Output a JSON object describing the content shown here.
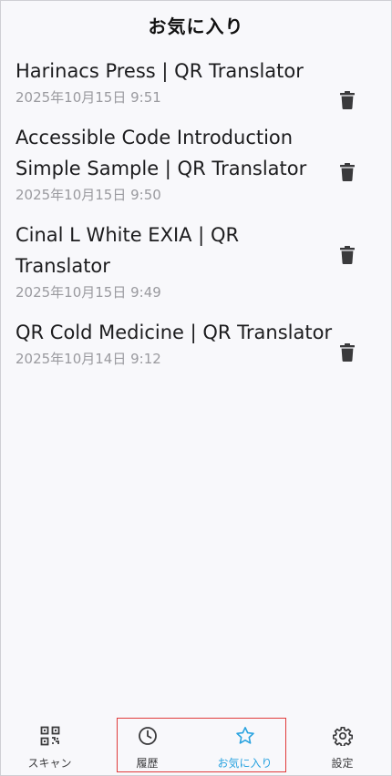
{
  "header": {
    "title": "お気に入り"
  },
  "favorites": [
    {
      "title": "Harinacs Press | QR Translator",
      "date": "2025年10月15日 9:51"
    },
    {
      "title": "Accessible Code Introduction Simple Sample | QR Translator",
      "date": "2025年10月15日 9:50"
    },
    {
      "title": "Cinal L White EXIA | QR Translator",
      "date": "2025年10月15日 9:49"
    },
    {
      "title": "QR Cold Medicine | QR Translator",
      "date": "2025年10月14日 9:12"
    }
  ],
  "tabbar": {
    "tabs": [
      {
        "label": "スキャン",
        "icon": "qr-code-icon",
        "active": false
      },
      {
        "label": "履歴",
        "icon": "clock-icon",
        "active": false
      },
      {
        "label": "お気に入り",
        "icon": "star-icon",
        "active": true
      },
      {
        "label": "設定",
        "icon": "gear-icon",
        "active": false
      }
    ]
  },
  "colors": {
    "accent": "#2aa3e0",
    "highlight": "#e03b3b",
    "text": "#1c1c1e",
    "subtext": "#9a9a9f",
    "background": "#f8f8fb"
  }
}
